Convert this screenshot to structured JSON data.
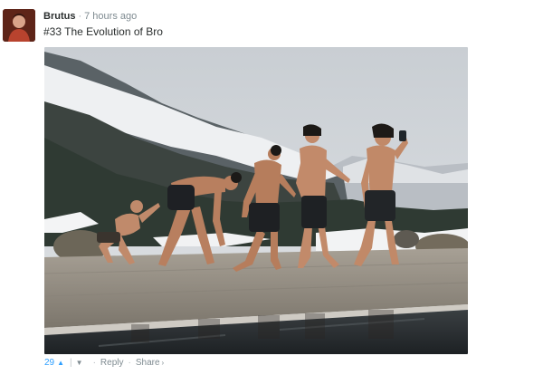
{
  "comment": {
    "author": "Brutus",
    "separator": "·",
    "timestamp": "7 hours ago",
    "text": "#33 The Evolution of Bro"
  },
  "footer": {
    "votes": "29",
    "up_icon": "▲",
    "pipe": "|",
    "down_icon": "▼",
    "dot1": "·",
    "reply_label": "Reply",
    "dot2": "·",
    "share_label": "Share",
    "share_arrow": "›"
  },
  "colors": {
    "accent": "#2e9fff",
    "muted": "#7f8b91",
    "text": "#2a2e2e"
  },
  "icons": [
    "avatar",
    "upvote-arrow-icon",
    "downvote-arrow-icon",
    "share-arrow-icon"
  ]
}
